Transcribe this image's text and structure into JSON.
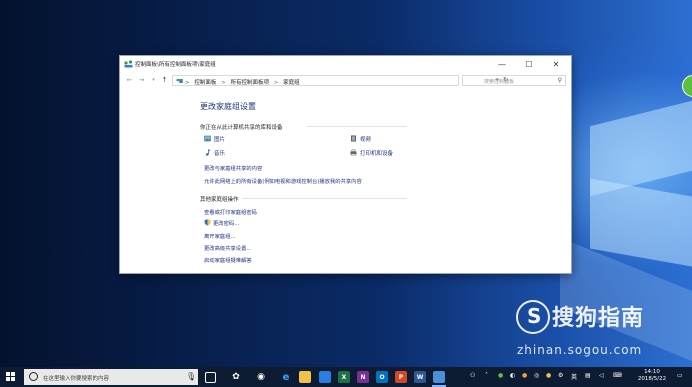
{
  "window": {
    "title": "控制面板\\所有控制面板项\\家庭组",
    "controls": {
      "minimize": "—",
      "maximize": "☐",
      "close": "✕"
    }
  },
  "address": {
    "crumbs": [
      "控制面板",
      "所有控制面板项",
      "家庭组"
    ],
    "separator": ">",
    "search_placeholder": "搜索控制面板"
  },
  "content": {
    "heading": "更改家庭组设置",
    "section_sharing": "你正在从此计算机共享的库和设备",
    "shared_items": {
      "pictures": "图片",
      "videos": "视频",
      "music": "音乐",
      "printers": "打印机和设备"
    },
    "sharing_links": [
      "更改与家庭组共享的内容",
      "允许此网络上的所有设备(例如电视和游戏控制台)播放我的共享内容"
    ],
    "section_other": "其他家庭组操作",
    "other_links": [
      "查看或打印家庭组密码",
      "更改密码...",
      "离开家庭组...",
      "更改高级共享设置...",
      "启动家庭组疑难解答"
    ]
  },
  "taskbar": {
    "search_placeholder": "在这里输入你要搜索的内容",
    "tray_lang": "英",
    "time": "14:10",
    "date": "2018/5/22"
  },
  "watermark": {
    "brand": "搜狗指南",
    "url": "zhinan.sogou.com"
  },
  "colors": {
    "link": "#1e3287",
    "taskbar": "#0d1c33"
  }
}
